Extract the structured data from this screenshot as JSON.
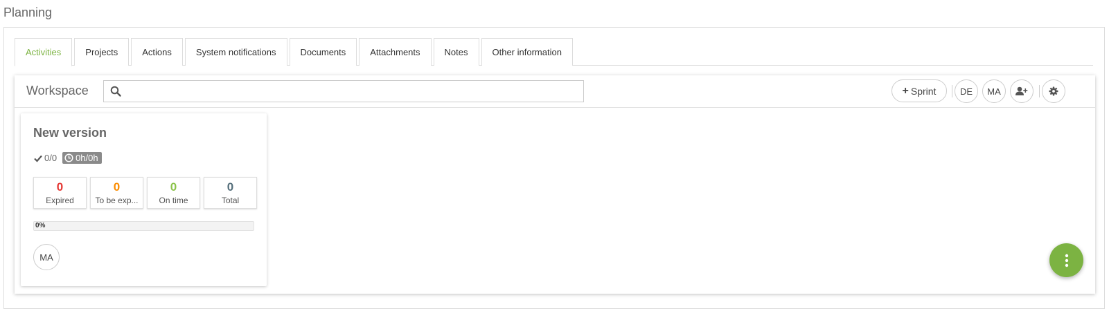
{
  "page": {
    "title": "Planning"
  },
  "tabs": [
    {
      "label": "Activities",
      "active": true
    },
    {
      "label": "Projects"
    },
    {
      "label": "Actions"
    },
    {
      "label": "System notifications"
    },
    {
      "label": "Documents"
    },
    {
      "label": "Attachments"
    },
    {
      "label": "Notes"
    },
    {
      "label": "Other information"
    }
  ],
  "workspace": {
    "title": "Workspace",
    "search": {
      "value": "",
      "placeholder": "",
      "icon": "search-icon"
    },
    "sprint_button": {
      "label": "Sprint",
      "icon": "plus-icon"
    },
    "members": [
      "DE",
      "MA"
    ],
    "add_member_icon": "user-plus-icon",
    "settings_icon": "gear-icon"
  },
  "card": {
    "title": "New version",
    "checks": "0/0",
    "check_icon": "check-icon",
    "time": "0h/0h",
    "clock_icon": "clock-icon",
    "stats": [
      {
        "value": "0",
        "label": "Expired",
        "color": "#e53935"
      },
      {
        "value": "0",
        "label": "To be exp...",
        "color": "#fb8c00"
      },
      {
        "value": "0",
        "label": "On time",
        "color": "#8bc34a"
      },
      {
        "value": "0",
        "label": "Total",
        "color": "#546e7a"
      }
    ],
    "progress": {
      "text": "0%",
      "percent": 0
    },
    "assignee": "MA"
  },
  "fab": {
    "icon": "more-vertical-icon"
  },
  "colors": {
    "accent": "#7cb342"
  }
}
